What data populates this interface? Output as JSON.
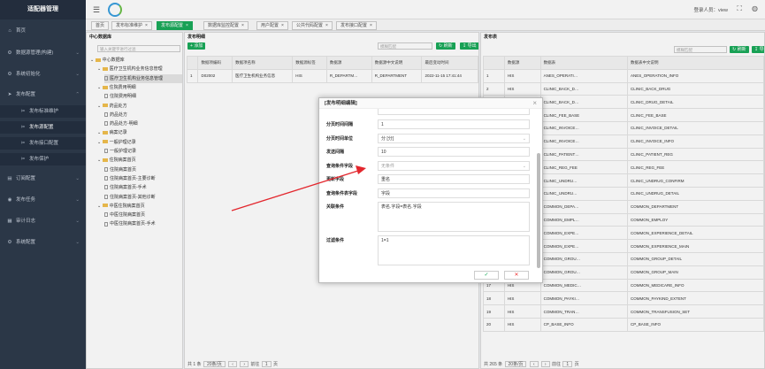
{
  "sidebar": {
    "brand": "适配器管理",
    "items": [
      {
        "icon": "home-icon",
        "label": "首页"
      },
      {
        "icon": "gear-icon",
        "label": "数据源管理(构建)"
      },
      {
        "icon": "gear-icon",
        "label": "系统初始化"
      },
      {
        "icon": "send-icon",
        "label": "发布配置"
      }
    ],
    "subitems": [
      {
        "label": "发布标准维护"
      },
      {
        "label": "发布源配置"
      },
      {
        "label": "发布接口配置"
      },
      {
        "label": "发布保护"
      }
    ],
    "items2": [
      {
        "icon": "clipboard-icon",
        "label": "订阅配置"
      },
      {
        "icon": "task-icon",
        "label": "发布任务"
      },
      {
        "icon": "log-icon",
        "label": "审计日志"
      },
      {
        "icon": "gear-icon",
        "label": "系统配置"
      }
    ]
  },
  "header": {
    "user_label": "登录人员：view"
  },
  "tabs": [
    {
      "label": "首页"
    },
    {
      "label": "发布标准维护"
    },
    {
      "label": "发布源配置"
    },
    {
      "label": "数据库监控配置"
    },
    {
      "label": "用户配置"
    },
    {
      "label": "公共代码配置"
    },
    {
      "label": "发布接口配置"
    }
  ],
  "tree": {
    "title": "中心数据库",
    "search_placeholder": "输入关键字进行过滤",
    "nodes": [
      {
        "type": "folder",
        "label": "中心数据库",
        "level": 0
      },
      {
        "type": "folder",
        "label": "医疗卫生机构业务信息管理",
        "level": 1
      },
      {
        "type": "file",
        "label": "医疗卫生机构业务信息管理",
        "level": 2,
        "selected": true
      },
      {
        "type": "folder",
        "label": "住院费用明细",
        "level": 1
      },
      {
        "type": "file",
        "label": "住院费用明细",
        "level": 2
      },
      {
        "type": "folder",
        "label": "药品处方",
        "level": 1
      },
      {
        "type": "file",
        "label": "药品处方",
        "level": 2
      },
      {
        "type": "file",
        "label": "药品处方-明细",
        "level": 2
      },
      {
        "type": "folder",
        "label": "病案记录",
        "level": 1
      },
      {
        "type": "folder",
        "label": "一般护理记录",
        "level": 1
      },
      {
        "type": "file",
        "label": "一般护理记录",
        "level": 2
      },
      {
        "type": "folder",
        "label": "住院病案首页",
        "level": 1
      },
      {
        "type": "file",
        "label": "住院病案首页",
        "level": 2
      },
      {
        "type": "file",
        "label": "住院病案首页-主要诊断",
        "level": 2
      },
      {
        "type": "file",
        "label": "住院病案首页-手术",
        "level": 2
      },
      {
        "type": "file",
        "label": "住院病案首页-其他诊断",
        "level": 2
      },
      {
        "type": "folder",
        "label": "中医住院病案首页",
        "level": 1
      },
      {
        "type": "file",
        "label": "中医住院病案首页",
        "level": 2
      },
      {
        "type": "file",
        "label": "中医住院病案首页-手术",
        "level": 2
      }
    ]
  },
  "mid": {
    "title": "发布明细",
    "add_label": "添加",
    "search_placeholder": "模糊匹配",
    "refresh_label": "刷新",
    "export_label": "导出",
    "columns": [
      "",
      "数据项编码",
      "数据项名称",
      "数据源标签",
      "数据源",
      "数据源中文说明",
      "最后变动时间"
    ],
    "rows": [
      [
        "1",
        "D02002",
        "医疗卫生机构业务信息",
        "HIS",
        "R_DEPARTM…",
        "R_DEPARTMENT",
        "2022-11-15 17:41:44"
      ]
    ],
    "pager": {
      "total": "共 1 条",
      "size": "20条/页",
      "goto_label": "前往",
      "page": "1",
      "page_suffix": "页"
    }
  },
  "right": {
    "title": "发布表",
    "search_placeholder": "模糊匹配",
    "refresh_label": "刷新",
    "export_label": "导出",
    "columns": [
      "",
      "数据源",
      "数据表",
      "数据表中文说明"
    ],
    "rows": [
      [
        "1",
        "HIS",
        "ANES_OPERATI…",
        "ANES_OPERATION_INFO"
      ],
      [
        "2",
        "HIS",
        "CLINIC_BACK_D…",
        "CLINIC_BACK_DRUG"
      ],
      [
        "3",
        "HIS",
        "CLINIC_BACK_D…",
        "CLINIC_DRUG_DETAIL"
      ],
      [
        "4",
        "HIS",
        "CLINIC_FEE_BASE",
        "CLINIC_FEE_BASE"
      ],
      [
        "5",
        "HIS",
        "CLINIC_INVOICE…",
        "CLINIC_INVOICE_DETAIL"
      ],
      [
        "6",
        "HIS",
        "CLINIC_INVOICE…",
        "CLINIC_INVOICE_INFO"
      ],
      [
        "7",
        "HIS",
        "CLINIC_PATIENT…",
        "CLINIC_PATIENT_REG"
      ],
      [
        "8",
        "HIS",
        "CLINIC_REG_FEE",
        "CLINIC_REG_FEE"
      ],
      [
        "9",
        "HIS",
        "CLINIC_UNDRU…",
        "CLINIC_UNDRUG_CONFIRM"
      ],
      [
        "10",
        "HIS",
        "CLINIC_UNDRU…",
        "CLINIC_UNDRUG_DETAIL"
      ],
      [
        "11",
        "HIS",
        "COMMON_DEPA…",
        "COMMON_DEPARTMENT"
      ],
      [
        "12",
        "HIS",
        "COMMON_EMPL…",
        "COMMON_EMPLOY"
      ],
      [
        "13",
        "HIS",
        "COMMON_EXPE…",
        "COMMON_EXPERIENCE_DETAIL"
      ],
      [
        "14",
        "HIS",
        "COMMON_EXPE…",
        "COMMON_EXPERIENCE_MAIN"
      ],
      [
        "15",
        "HIS",
        "COMMON_GROU…",
        "COMMON_GROUP_DETAIL"
      ],
      [
        "16",
        "HIS",
        "COMMON_GROU…",
        "COMMON_GROUP_MAIN"
      ],
      [
        "17",
        "HIS",
        "COMMON_MEDIC…",
        "COMMON_MEDICARE_INFO"
      ],
      [
        "18",
        "HIS",
        "COMMON_PAYKI…",
        "COMMON_PAYKIND_EXTENT"
      ],
      [
        "19",
        "HIS",
        "COMMON_TRAN…",
        "COMMON_TRANSFUSION_SET"
      ],
      [
        "20",
        "HIS",
        "CP_BASE_INFO",
        "CP_BASE_INFO"
      ]
    ],
    "pager": {
      "total": "共 265 条",
      "size": "20条/页",
      "goto_label": "前往",
      "page": "1",
      "page_suffix": "页"
    }
  },
  "modal": {
    "title": "[发布明细编辑]",
    "fields": [
      {
        "label": "分页时间间隔",
        "value": "1"
      },
      {
        "label": "分页时间单位",
        "value": "分 [分]",
        "dropdown": true
      },
      {
        "label": "发送间隔",
        "value": "10"
      },
      {
        "label": "查询条件字段",
        "value": "无条件",
        "dropdown": true,
        "placeholder": true
      },
      {
        "label": "更新字段",
        "value": "重名"
      },
      {
        "label": "查询条件表字段",
        "value": "字段"
      },
      {
        "label": "关联条件",
        "value": "表名.字段=表名.字段",
        "textarea": true
      },
      {
        "label": "过滤条件",
        "value": "1=1",
        "textarea": true
      }
    ],
    "ok_label": "✓",
    "cancel_label": "✕"
  },
  "annotation": {
    "color": "#e3262d"
  }
}
